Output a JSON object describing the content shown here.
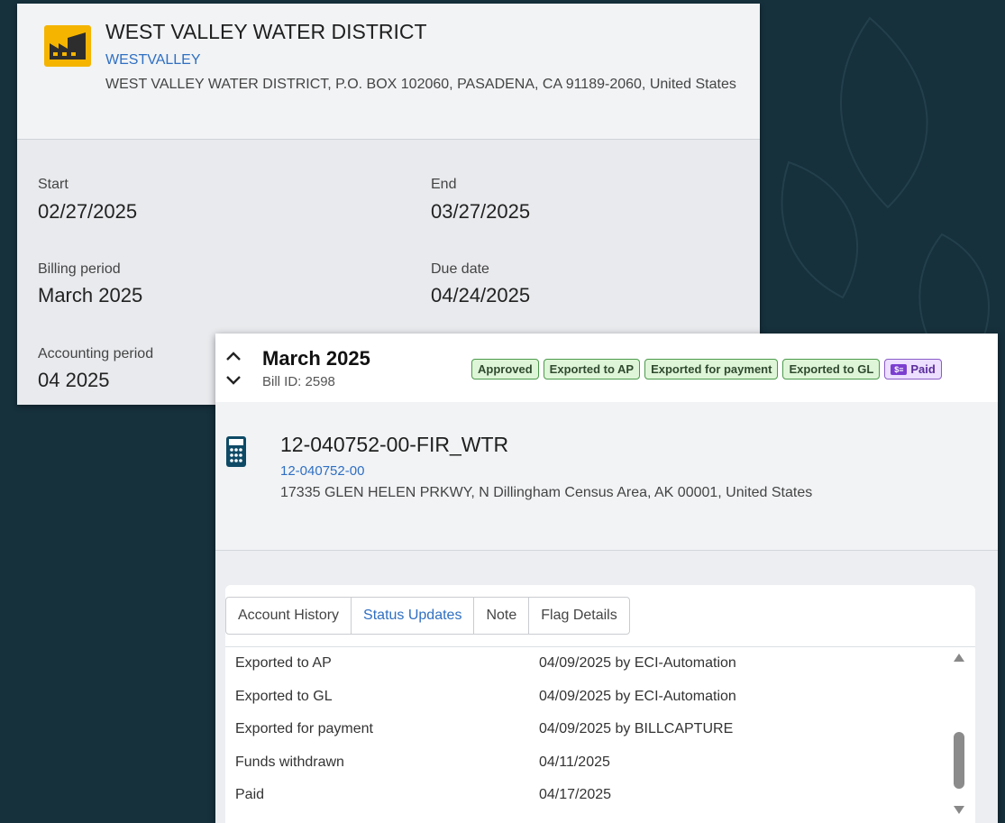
{
  "vendor": {
    "name": "WEST VALLEY WATER DISTRICT",
    "code": "WESTVALLEY",
    "address": "WEST VALLEY WATER DISTRICT, P.O. BOX 102060, PASADENA, CA 91189-2060, United States",
    "icon": "factory-icon",
    "icon_color": "#f4b400"
  },
  "fields": {
    "start_label": "Start",
    "start_value": "02/27/2025",
    "end_label": "End",
    "end_value": "03/27/2025",
    "billing_label": "Billing period",
    "billing_value": "March 2025",
    "due_label": "Due date",
    "due_value": "04/24/2025",
    "accounting_label": "Accounting period",
    "accounting_value": "04 2025"
  },
  "bill": {
    "title": "March 2025",
    "bill_id": "Bill ID: 2598",
    "badges": [
      "Approved",
      "Exported to AP",
      "Exported for payment",
      "Exported to GL"
    ],
    "paid_badge": "Paid",
    "paid_icon_text": "$≡"
  },
  "account": {
    "name": "12-040752-00-FIR_WTR",
    "number": "12-040752-00",
    "address": "17335 GLEN HELEN PRKWY, N Dillingham Census Area, AK 00001, United States",
    "icon": "calculator-icon",
    "icon_color": "#0e4a66"
  },
  "tabs": [
    "Account History",
    "Status Updates",
    "Note",
    "Flag Details"
  ],
  "active_tab": "Status Updates",
  "status_rows": [
    {
      "status": "Exported to AP",
      "detail": "04/09/2025 by ECI-Automation"
    },
    {
      "status": "Exported to GL",
      "detail": "04/09/2025 by ECI-Automation"
    },
    {
      "status": "Exported for payment",
      "detail": "04/09/2025 by BILLCAPTURE"
    },
    {
      "status": "Funds withdrawn",
      "detail": "04/11/2025"
    },
    {
      "status": "Paid",
      "detail": "04/17/2025"
    }
  ]
}
